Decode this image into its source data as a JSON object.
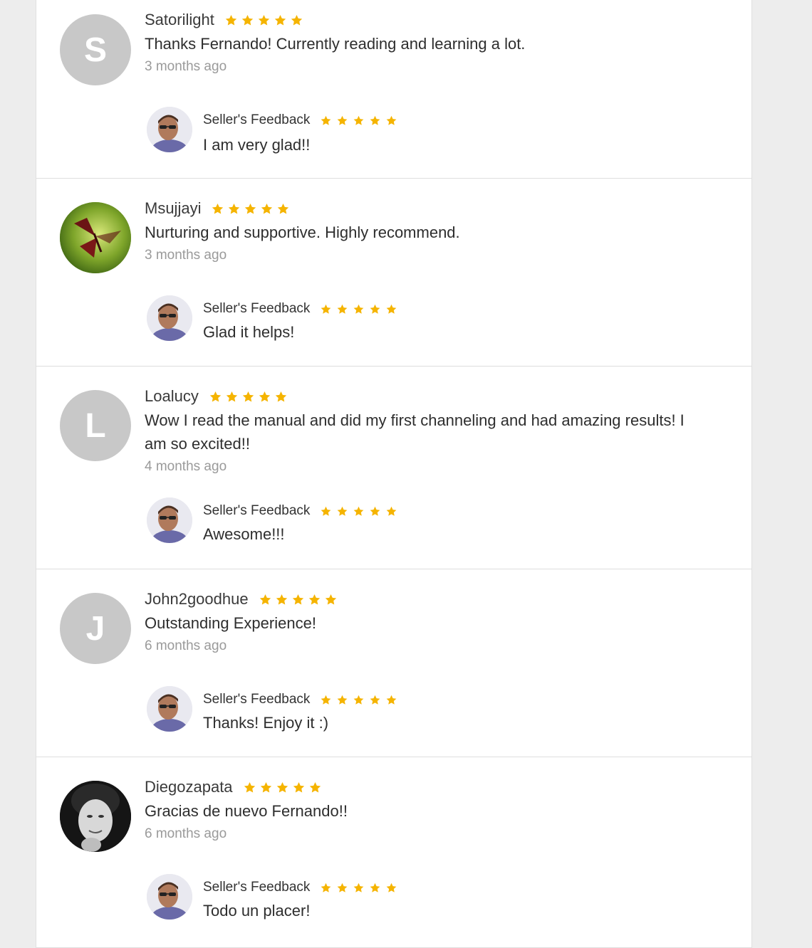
{
  "colors": {
    "star": "#f5b400",
    "letter_avatar_bg": "#c8c8c8",
    "page_bg": "#ededed",
    "panel_bg": "#ffffff",
    "time_text": "#9a9a9a"
  },
  "icons": {
    "star": "star-icon",
    "seller_avatar": "seller-photo-avatar"
  },
  "seller_label": "Seller's Feedback",
  "reviews": [
    {
      "username": "Satorilight",
      "avatar_letter": "S",
      "rating": 5,
      "text": "Thanks Fernando! Currently reading and learning a lot.",
      "time": "3 months ago",
      "seller_rating": 5,
      "seller_text": "I am very glad!!"
    },
    {
      "username": "Msujjayi",
      "avatar_letter": "",
      "avatar_icon": "dragonfly-photo-avatar",
      "rating": 5,
      "text": "Nurturing and supportive. Highly recommend.",
      "time": "3 months ago",
      "seller_rating": 5,
      "seller_text": "Glad it helps!"
    },
    {
      "username": "Loalucy",
      "avatar_letter": "L",
      "rating": 5,
      "text": "Wow I read the manual and did my first channeling and had amazing results! I am so excited!!",
      "time": "4 months ago",
      "seller_rating": 5,
      "seller_text": "Awesome!!!"
    },
    {
      "username": "John2goodhue",
      "avatar_letter": "J",
      "rating": 5,
      "text": "Outstanding Experience!",
      "time": "6 months ago",
      "seller_rating": 5,
      "seller_text": "Thanks! Enjoy it :)"
    },
    {
      "username": "Diegozapata",
      "avatar_letter": "",
      "avatar_icon": "portrait-photo-avatar",
      "rating": 5,
      "text": "Gracias de nuevo Fernando!!",
      "time": "6 months ago",
      "seller_rating": 5,
      "seller_text": "Todo un placer!"
    }
  ]
}
